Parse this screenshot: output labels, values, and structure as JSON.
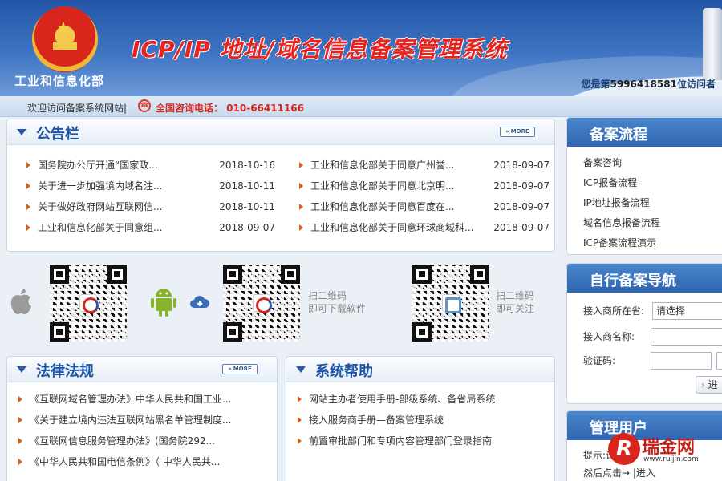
{
  "header": {
    "ministry": "工业和信息化部",
    "system_title": "ICP/IP 地址/域名信息备案管理系统",
    "visitor_prefix": "您是第",
    "visitor_count": "5996418581",
    "visitor_suffix": "位访问者"
  },
  "welcome": {
    "text": "欢迎访问备案系统网站|",
    "hotline": "全国咨询电话：  010-66411166"
  },
  "notice": {
    "title": "公告栏",
    "more": "MORE",
    "left": [
      {
        "title": "国务院办公厅开通“国家政...",
        "date": "2018-10-16"
      },
      {
        "title": "关于进一步加强境内域名注...",
        "date": "2018-10-11"
      },
      {
        "title": "关于做好政府网站互联网信...",
        "date": "2018-10-11"
      },
      {
        "title": "工业和信息化部关于同意组...",
        "date": "2018-09-07"
      }
    ],
    "right": [
      {
        "title": "工业和信息化部关于同意广州誉...",
        "date": "2018-09-07"
      },
      {
        "title": "工业和信息化部关于同意北京明...",
        "date": "2018-09-07"
      },
      {
        "title": "工业和信息化部关于同意百度在...",
        "date": "2018-09-07"
      },
      {
        "title": "工业和信息化部关于同意环球商域科...",
        "date": "2018-09-07"
      }
    ]
  },
  "apps": {
    "download_caption_1": "扫二维码",
    "download_caption_2": "即可下载软件",
    "follow_caption_1": "扫二维码",
    "follow_caption_2": "即可关注"
  },
  "law": {
    "title": "法律法规",
    "more": "MORE",
    "items": [
      "《互联网域名管理办法》中华人民共和国工业...",
      "《关于建立境内违法互联网站黑名单管理制度...",
      "《互联网信息服务管理办法》(国务院292...",
      "《中华人民共和国电信条例》（ 中华人民共..."
    ]
  },
  "help": {
    "title": "系统帮助",
    "items": [
      "网站主办者使用手册-部级系统、备省局系统",
      "接入服务商手册—备案管理系统",
      "前置审批部门和专项内容管理部门登录指南"
    ]
  },
  "flow": {
    "title": "备案流程",
    "items": [
      "备案咨询",
      "ICP报备流程",
      "IP地址报备流程",
      "域名信息报备流程",
      "ICP备案流程演示"
    ]
  },
  "nav": {
    "title": "自行备案导航",
    "provider_label": "接入商所在省:",
    "provider_value": "请选择",
    "name_label": "接入商名称:",
    "captcha_label": "验证码:",
    "enter_button": "进"
  },
  "admin": {
    "title": "管理用户",
    "hint": "提示:请",
    "hint2": "然后点击→ |进入"
  },
  "watermark": {
    "name": "瑞金网",
    "url": "www.ruijin.com"
  },
  "colors": {
    "header_blue": "#2456a8",
    "title_red": "#e8241e",
    "panel_title_blue": "#1d56a6",
    "bullet_orange": "#e45b14",
    "hotline_red": "#d8261c"
  }
}
